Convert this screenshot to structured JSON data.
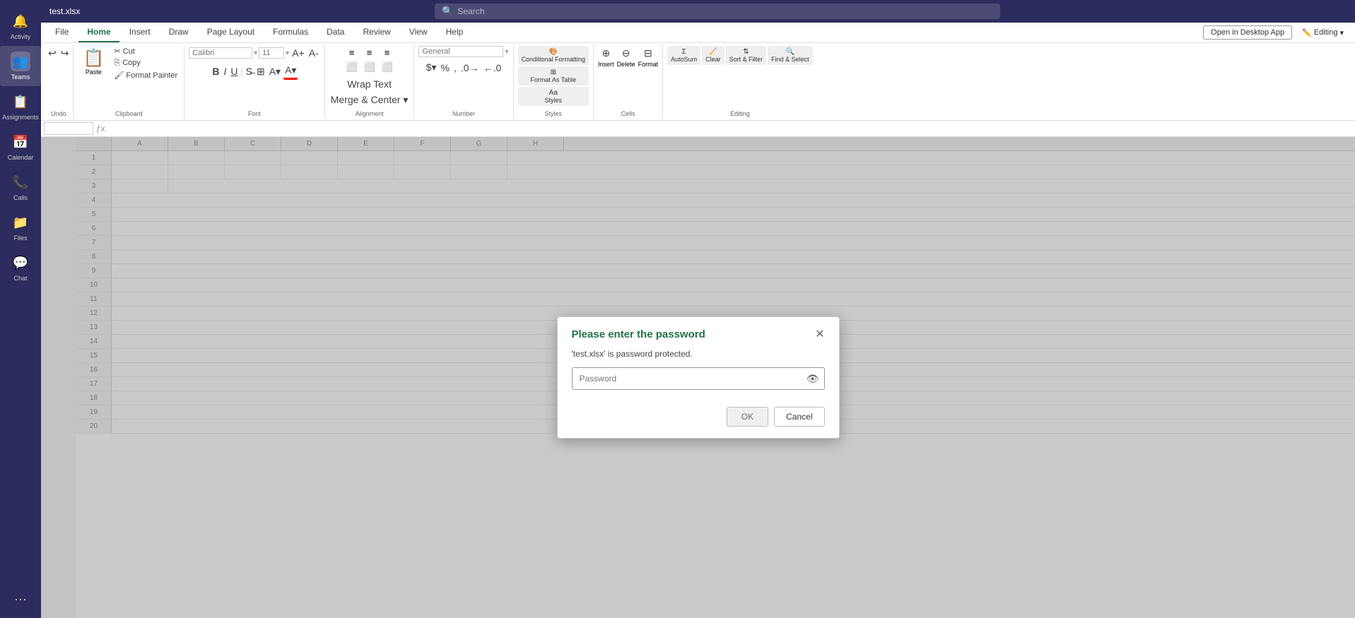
{
  "app": {
    "title": "test.xlsx",
    "background_color": "#2d2c5e"
  },
  "search": {
    "placeholder": "Search"
  },
  "sidebar": {
    "items": [
      {
        "id": "activity",
        "label": "Activity",
        "icon": "🔔",
        "active": false
      },
      {
        "id": "teams",
        "label": "Teams",
        "icon": "👥",
        "active": true
      },
      {
        "id": "assignments",
        "label": "Assignments",
        "icon": "📋",
        "active": false
      },
      {
        "id": "calendar",
        "label": "Calendar",
        "icon": "📅",
        "active": false
      },
      {
        "id": "calls",
        "label": "Calls",
        "icon": "📞",
        "active": false
      },
      {
        "id": "files",
        "label": "Files",
        "icon": "📁",
        "active": false
      },
      {
        "id": "chat",
        "label": "Chat",
        "icon": "💬",
        "active": false
      }
    ],
    "more_label": "···"
  },
  "ribbon": {
    "tabs": [
      {
        "id": "file",
        "label": "File",
        "active": false
      },
      {
        "id": "home",
        "label": "Home",
        "active": true
      },
      {
        "id": "insert",
        "label": "Insert",
        "active": false
      },
      {
        "id": "draw",
        "label": "Draw",
        "active": false
      },
      {
        "id": "page_layout",
        "label": "Page Layout",
        "active": false
      },
      {
        "id": "formulas",
        "label": "Formulas",
        "active": false
      },
      {
        "id": "data",
        "label": "Data",
        "active": false
      },
      {
        "id": "review",
        "label": "Review",
        "active": false
      },
      {
        "id": "view",
        "label": "View",
        "active": false
      },
      {
        "id": "help",
        "label": "Help",
        "active": false
      }
    ],
    "open_desktop_btn": "Open in Desktop App",
    "editing_label": "Editing",
    "groups": {
      "undo": {
        "label": "Undo"
      },
      "clipboard": {
        "label": "Clipboard",
        "paste": "Paste",
        "cut": "Cut",
        "copy": "Copy",
        "format_painter": "Format Painter"
      },
      "font": {
        "label": "Font",
        "font_name_placeholder": "Calibri",
        "font_size_placeholder": "11",
        "bold": "B",
        "italic": "I",
        "underline": "U"
      },
      "alignment": {
        "label": "Alignment",
        "wrap_text": "Wrap Text",
        "merge_center": "Merge & Center"
      },
      "number": {
        "label": "Number",
        "format_placeholder": "General"
      },
      "styles": {
        "label": "Styles",
        "conditional_formatting": "Conditional Formatting",
        "format_as_table": "Format As Table",
        "cell_styles": "Styles"
      },
      "cells": {
        "label": "Cells",
        "insert": "Insert",
        "delete": "Delete",
        "format": "Format"
      },
      "editing": {
        "label": "Editing",
        "autosum": "AutoSum",
        "clear": "Clear",
        "sort_filter": "Sort & Filter",
        "find_select": "Find & Select"
      }
    }
  },
  "formula_bar": {
    "name_box_value": "",
    "formula_value": ""
  },
  "dialog": {
    "title": "Please enter the password",
    "description": "'test.xlsx' is password protected.",
    "password_placeholder": "Password",
    "ok_label": "OK",
    "cancel_label": "Cancel"
  }
}
